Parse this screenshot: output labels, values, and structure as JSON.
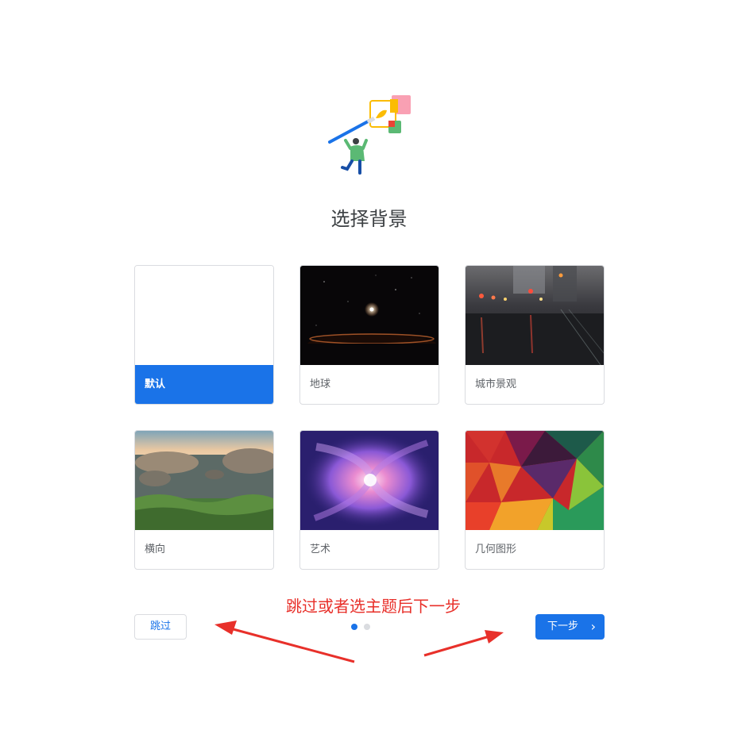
{
  "page": {
    "title": "选择背景",
    "annotation": "跳过或者选主题后下一步"
  },
  "backgrounds": [
    {
      "label": "默认",
      "selected": true
    },
    {
      "label": "地球",
      "selected": false
    },
    {
      "label": "城市景观",
      "selected": false
    },
    {
      "label": "横向",
      "selected": false
    },
    {
      "label": "艺术",
      "selected": false
    },
    {
      "label": "几何图形",
      "selected": false
    }
  ],
  "footer": {
    "skip_label": "跳过",
    "next_label": "下一步",
    "next_icon": "chevron-right-icon",
    "pager": {
      "current": 1,
      "total": 2
    }
  },
  "colors": {
    "accent": "#1a73e8",
    "annotation": "#e8302a",
    "inactive_dot": "#dadce0"
  }
}
